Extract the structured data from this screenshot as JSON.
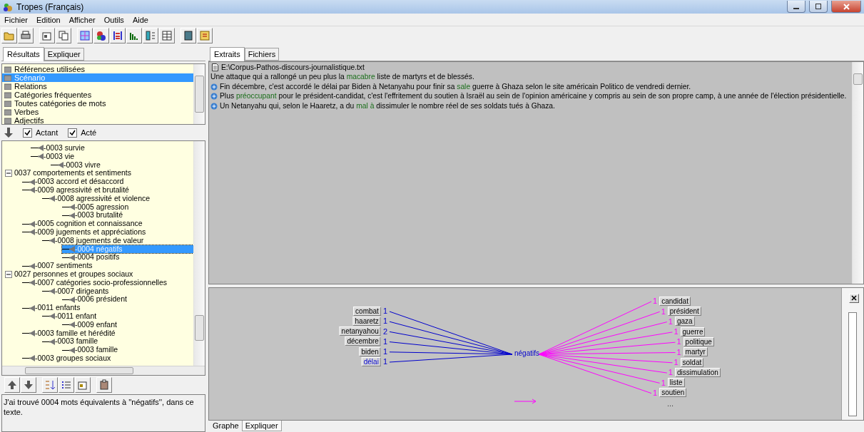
{
  "window": {
    "title": "Tropes (Français)"
  },
  "menu": [
    "Fichier",
    "Edition",
    "Afficher",
    "Outils",
    "Aide"
  ],
  "left_tabs": [
    {
      "label": "Résultats",
      "selected": true
    },
    {
      "label": "Expliquer",
      "selected": false
    }
  ],
  "results": [
    {
      "label": "Références utilisées",
      "selected": false
    },
    {
      "label": "Scénario",
      "selected": true
    },
    {
      "label": "Relations",
      "selected": false
    },
    {
      "label": "Catégories fréquentes",
      "selected": false
    },
    {
      "label": "Toutes catégories de mots",
      "selected": false
    },
    {
      "label": "Verbes",
      "selected": false
    },
    {
      "label": "Adjectifs",
      "selected": false
    }
  ],
  "filters": [
    {
      "label": "Actant",
      "checked": true
    },
    {
      "label": "Acté",
      "checked": true
    }
  ],
  "tree": [
    {
      "children": [
        {
          "children": [
            {
              "label": "-0003 survie",
              "selected": false
            },
            {
              "label": "-0003 vie",
              "selected": false,
              "children": [
                {
                  "label": "-0003 vivre",
                  "selected": false
                }
              ]
            }
          ]
        }
      ]
    },
    {
      "label": "0037 comportements et sentiments",
      "expanded": true,
      "selected": false,
      "children": [
        {
          "label": "-0003 accord et désaccord",
          "selected": false
        },
        {
          "label": "-0009 agressivité et brutalité",
          "selected": false,
          "children": [
            {
              "label": "-0008 agressivité et violence",
              "selected": false,
              "children": [
                {
                  "label": "-0005 agression",
                  "selected": false
                },
                {
                  "label": "-0003 brutalité",
                  "selected": false
                }
              ]
            }
          ]
        },
        {
          "label": "-0005 cognition et connaissance",
          "selected": false
        },
        {
          "label": "-0009 jugements et appréciations",
          "selected": false,
          "children": [
            {
              "label": "-0008 jugements de valeur",
              "selected": false,
              "children": [
                {
                  "label": "-0004 négatifs",
                  "selected": true
                },
                {
                  "label": "-0004 positifs",
                  "selected": false
                }
              ]
            }
          ]
        },
        {
          "label": "-0007 sentiments",
          "selected": false
        }
      ]
    },
    {
      "label": "0027 personnes et groupes sociaux",
      "expanded": true,
      "selected": false,
      "children": [
        {
          "label": "-0007 catégories socio-professionnelles",
          "selected": false,
          "children": [
            {
              "label": "-0007 dirigeants",
              "selected": false,
              "children": [
                {
                  "label": "-0006 président",
                  "selected": false
                }
              ]
            }
          ]
        },
        {
          "label": "-0011 enfants",
          "selected": false,
          "children": [
            {
              "label": "-0011 enfant",
              "selected": false,
              "children": [
                {
                  "label": "-0009 enfant",
                  "selected": false
                }
              ]
            }
          ]
        },
        {
          "label": "-0003 famille et hérédité",
          "selected": false,
          "children": [
            {
              "label": "-0003 famille",
              "selected": false,
              "children": [
                {
                  "label": "-0003 famille",
                  "selected": false
                }
              ]
            }
          ]
        },
        {
          "label": "-0003 groupes sociaux",
          "selected": false
        }
      ]
    }
  ],
  "message": "J'ai trouvé 0004 mots équivalents à ''négatifs'', dans ce texte.",
  "right_tabs": [
    {
      "label": "Extraits",
      "selected": true
    },
    {
      "label": "Fichiers",
      "selected": false
    }
  ],
  "extracts": {
    "file": "E:\\Corpus-Pathos-discours-journalistique.txt",
    "lines": [
      {
        "bullet": false,
        "segments": [
          {
            "text": "Une attaque qui a rallongé un peu plus la ",
            "highlighted": false
          },
          {
            "text": "macabre",
            "highlighted": true
          },
          {
            "text": " liste de martyrs et de blessés.",
            "highlighted": false
          }
        ]
      },
      {
        "bullet": true,
        "segments": [
          {
            "text": "Fin décembre, c'est accordé le délai par Biden à Netanyahu pour finir sa ",
            "highlighted": false
          },
          {
            "text": "sale",
            "highlighted": true
          },
          {
            "text": " guerre à Ghaza selon le site américain Politico de vendredi dernier.",
            "highlighted": false
          }
        ]
      },
      {
        "bullet": true,
        "segments": [
          {
            "text": "Plus ",
            "highlighted": false
          },
          {
            "text": "préoccupant",
            "highlighted": true
          },
          {
            "text": " pour le président-candidat, c'est l'effritement du soutien à Israël au sein de l'opinion américaine y compris au sein de son propre camp, à une année de l'élection présidentielle.",
            "highlighted": false
          }
        ]
      },
      {
        "bullet": true,
        "segments": [
          {
            "text": "Un Netanyahu qui, selon le Haaretz, a du ",
            "highlighted": false
          },
          {
            "text": "mal à",
            "highlighted": true
          },
          {
            "text": " dissimuler le nombre réel de ses soldats tués à Ghaza.",
            "highlighted": false
          }
        ]
      }
    ]
  },
  "graph": {
    "center": "négatifs",
    "actants": [
      {
        "word": "combat",
        "count": "1",
        "highlighted": false
      },
      {
        "word": "haaretz",
        "count": "1",
        "highlighted": false
      },
      {
        "word": "netanyahou",
        "count": "2",
        "highlighted": false
      },
      {
        "word": "décembre",
        "count": "1",
        "highlighted": false
      },
      {
        "word": "biden",
        "count": "1",
        "highlighted": false
      },
      {
        "word": "délai",
        "count": "1",
        "highlighted": true
      }
    ],
    "actes": [
      {
        "word": "candidat",
        "count": "1"
      },
      {
        "word": "président",
        "count": "1"
      },
      {
        "word": "gaza",
        "count": "1"
      },
      {
        "word": "guerre",
        "count": "1"
      },
      {
        "word": "politique",
        "count": "1"
      },
      {
        "word": "martyr",
        "count": "1"
      },
      {
        "word": "soldat",
        "count": "1"
      },
      {
        "word": "dissimulation",
        "count": "1"
      },
      {
        "word": "liste",
        "count": "1"
      },
      {
        "word": "soutien",
        "count": "1"
      }
    ],
    "more": "...",
    "zoom_slider": {
      "level": 0
    }
  },
  "bottom_tabs": [
    {
      "label": "Graphe",
      "selected": true
    },
    {
      "label": "Expliquer",
      "selected": false
    }
  ]
}
